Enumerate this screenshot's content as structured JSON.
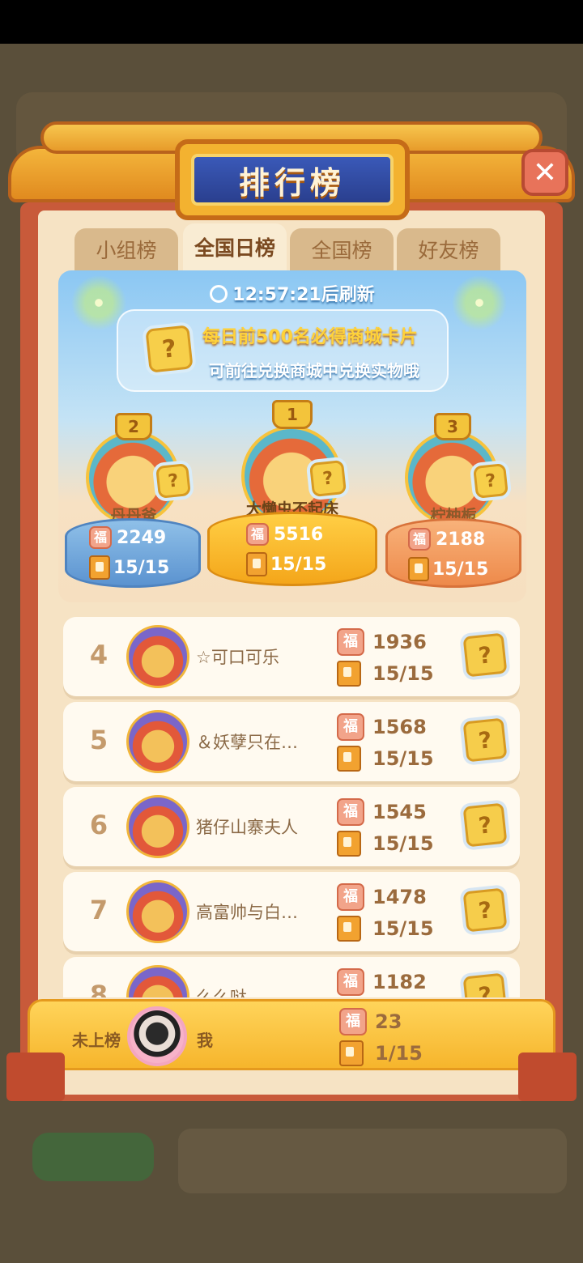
{
  "title": "排行榜",
  "close_icon": "close-icon",
  "tabs": [
    {
      "label": "小组榜",
      "active": false
    },
    {
      "label": "全国日榜",
      "active": true
    },
    {
      "label": "全国榜",
      "active": false
    },
    {
      "label": "好友榜",
      "active": false
    }
  ],
  "timer": "12:57:21后刷新",
  "notice": {
    "line1": "每日前500名必得商城卡片",
    "line2": "可前往兑换商城中兑换实物哦"
  },
  "top3": [
    {
      "rank": "2",
      "name": "丹丹爸",
      "score": "2249",
      "progress": "15/15"
    },
    {
      "rank": "1",
      "name": "大懒虫不起床",
      "score": "5516",
      "progress": "15/15"
    },
    {
      "rank": "3",
      "name": "柠柚栀",
      "score": "2188",
      "progress": "15/15"
    }
  ],
  "rows": [
    {
      "rank": "4",
      "name": "☆可口可乐",
      "score": "1936",
      "progress": "15/15"
    },
    {
      "rank": "5",
      "name": "＆妖孽只在…",
      "score": "1568",
      "progress": "15/15"
    },
    {
      "rank": "6",
      "name": "猪仔山寨夫人",
      "score": "1545",
      "progress": "15/15"
    },
    {
      "rank": "7",
      "name": "高富帅与白…",
      "score": "1478",
      "progress": "15/15"
    },
    {
      "rank": "8",
      "name": "么么哒",
      "score": "1182",
      "progress": ""
    }
  ],
  "me": {
    "status": "未上榜",
    "name": "我",
    "score": "23",
    "progress": "1/15"
  },
  "icons": {
    "fu": "福",
    "question": "?"
  },
  "colors": {
    "frame": "#c85a3a",
    "panel_bg": "#f6e3c4",
    "accent_gold": "#f6b52c",
    "title_blue": "#2a3f8e"
  }
}
